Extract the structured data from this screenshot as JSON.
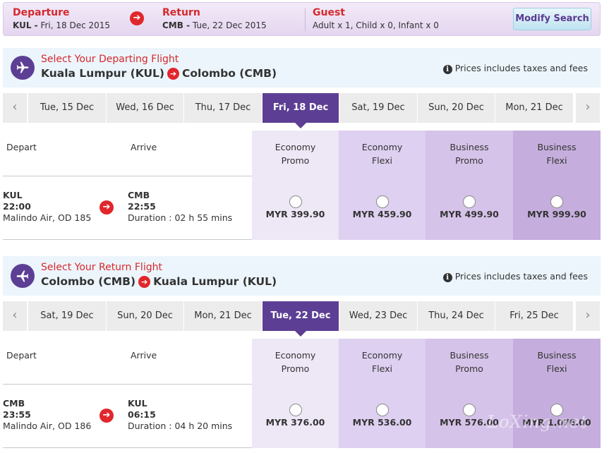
{
  "summary": {
    "departure": {
      "title": "Departure",
      "code": "KUL -",
      "date": "Fri, 18 Dec 2015"
    },
    "return": {
      "title": "Return",
      "code": "CMB -",
      "date": "Tue, 22 Dec 2015"
    },
    "guest": {
      "title": "Guest",
      "detail": "Adult x 1, Child x 0, Infant x 0"
    },
    "modify_label": "Modify Search",
    "arrow_icon": "➔"
  },
  "outbound": {
    "select_label": "Select Your Departing Flight",
    "from": "Kuala Lumpur (KUL)",
    "to": "Colombo (CMB)",
    "info": "Prices includes taxes and fees",
    "dates": [
      "Tue, 15 Dec",
      "Wed, 16 Dec",
      "Thu, 17 Dec",
      "Fri, 18 Dec",
      "Sat, 19 Dec",
      "Sun, 20 Dec",
      "Mon, 21 Dec"
    ],
    "active_index": 3,
    "headers": {
      "depart": "Depart",
      "arrive": "Arrive",
      "fares": [
        [
          "Economy",
          "Promo"
        ],
        [
          "Economy",
          "Flexi"
        ],
        [
          "Business",
          "Promo"
        ],
        [
          "Business",
          "Flexi"
        ]
      ]
    },
    "flight": {
      "dep_code": "KUL",
      "dep_time": "22:00",
      "carrier": "Malindo Air, OD 185",
      "arr_code": "CMB",
      "arr_time": "22:55",
      "duration": "Duration : 02 h 55 mins",
      "prices": [
        "MYR 399.90",
        "MYR 459.90",
        "MYR 499.90",
        "MYR 999.90"
      ]
    }
  },
  "inbound": {
    "select_label": "Select Your Return Flight",
    "from": "Colombo (CMB)",
    "to": "Kuala Lumpur (KUL)",
    "info": "Prices includes taxes and fees",
    "dates": [
      "Sat, 19 Dec",
      "Sun, 20 Dec",
      "Mon, 21 Dec",
      "Tue, 22 Dec",
      "Wed, 23 Dec",
      "Thu, 24 Dec",
      "Fri, 25 Dec"
    ],
    "active_index": 3,
    "headers": {
      "depart": "Depart",
      "arrive": "Arrive",
      "fares": [
        [
          "Economy",
          "Promo"
        ],
        [
          "Economy",
          "Flexi"
        ],
        [
          "Business",
          "Promo"
        ],
        [
          "Business",
          "Flexi"
        ]
      ]
    },
    "flight": {
      "dep_code": "CMB",
      "dep_time": "23:55",
      "carrier": "Malindo Air, OD 186",
      "arr_code": "KUL",
      "arr_time": "06:15",
      "duration": "Duration : 04 h 20 mins",
      "prices": [
        "MYR 376.00",
        "MYR 536.00",
        "MYR 576.00",
        "MYR 1,076.00"
      ]
    }
  },
  "watermark": "LoXing.net",
  "colors": {
    "brand_purple": "#5c3f94",
    "accent_red": "#d6282d",
    "arrow_red": "#e1262c"
  },
  "icons": {
    "prev": "‹",
    "next": "›",
    "info": "i",
    "plane": "plane-icon"
  }
}
